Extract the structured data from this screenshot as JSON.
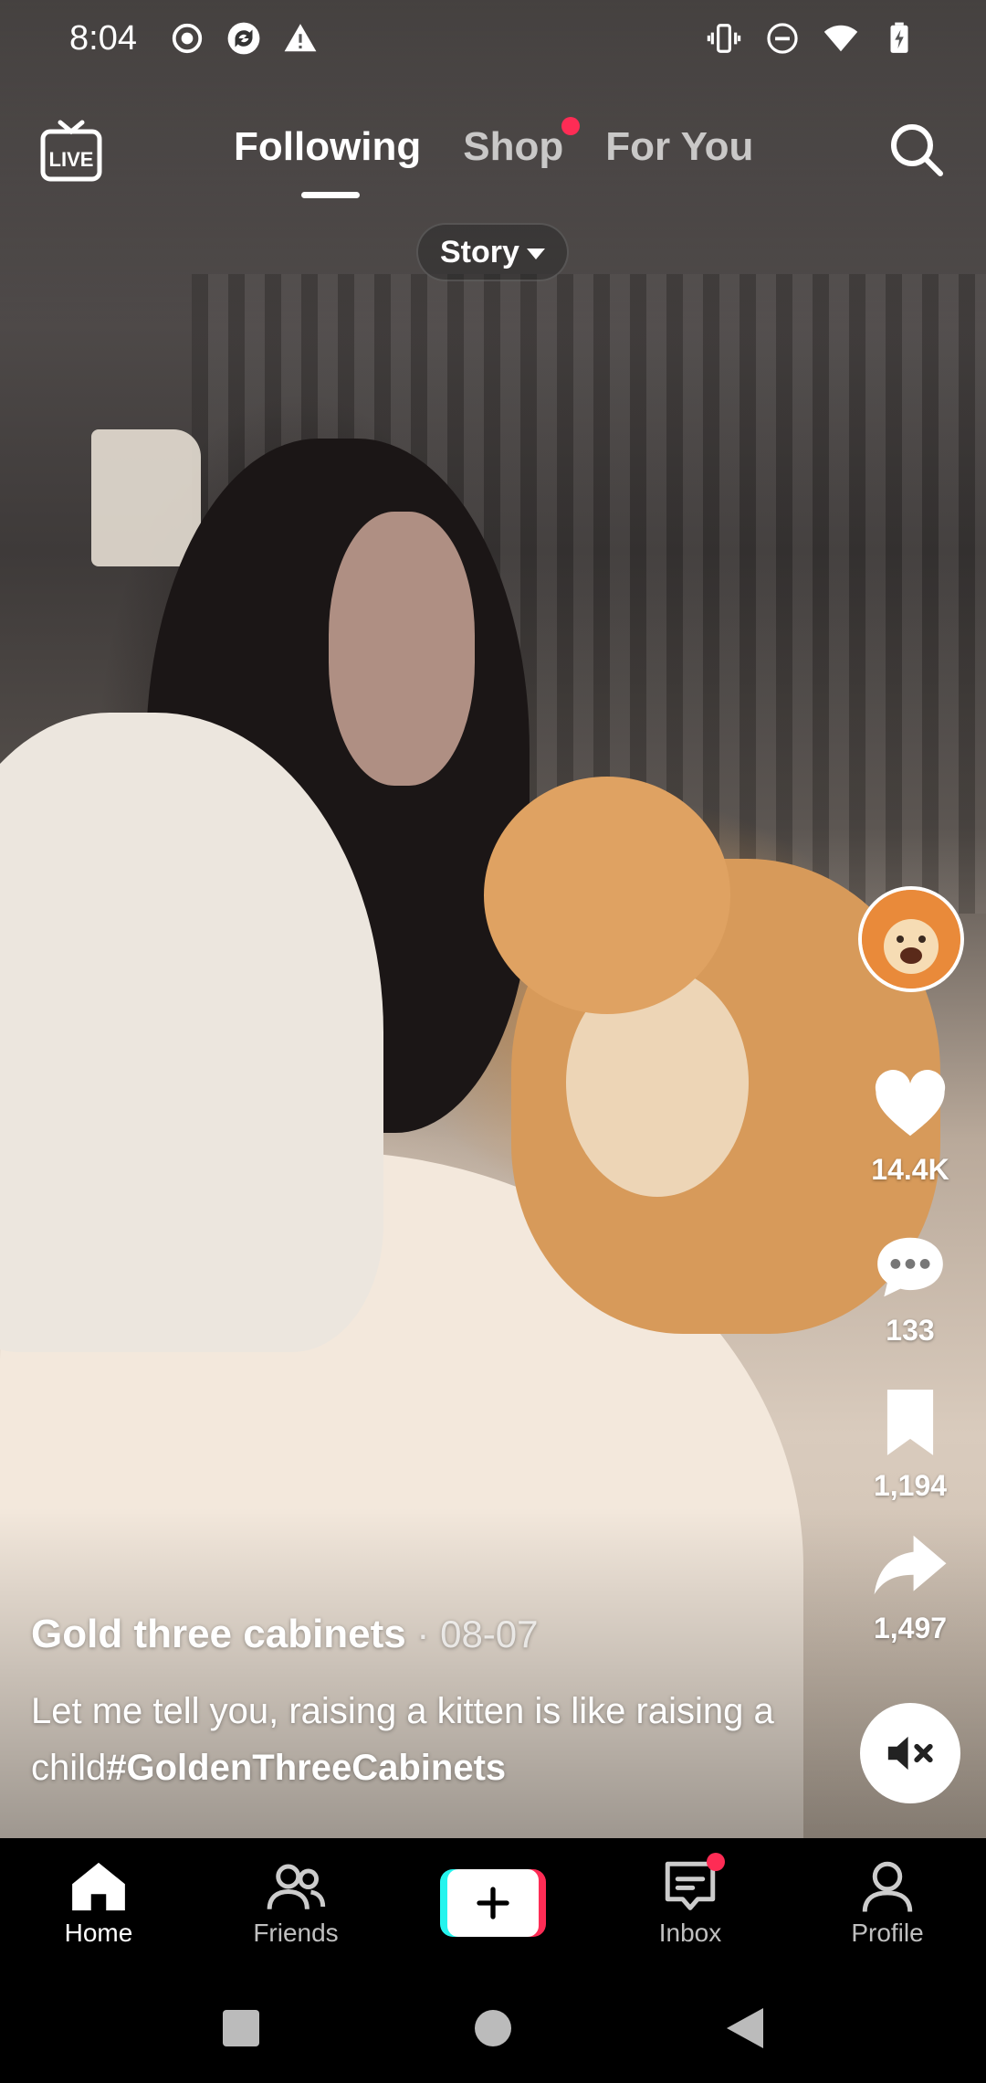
{
  "status_bar": {
    "time": "8:04",
    "left_icons": [
      "record-icon",
      "app-sync-icon",
      "warning-icon"
    ],
    "right_icons": [
      "vibrate-icon",
      "do-not-disturb-icon",
      "wifi-icon",
      "battery-charging-icon"
    ]
  },
  "top_nav": {
    "live_label": "LIVE",
    "tabs": [
      {
        "label": "Following",
        "active": true
      },
      {
        "label": "Shop",
        "active": false,
        "badge_dot": true
      },
      {
        "label": "For You",
        "active": false
      }
    ],
    "story_label": "Story"
  },
  "actions": {
    "likes": "14.4K",
    "comments": "133",
    "saves": "1,194",
    "shares": "1,497"
  },
  "post": {
    "author": "Gold three cabinets",
    "date": " · 08-07",
    "description": "Let me tell you, raising a kitten is like raising a child",
    "hashtag": "#GoldenThreeCabinets"
  },
  "tab_bar": {
    "home": "Home",
    "friends": "Friends",
    "inbox": "Inbox",
    "profile": "Profile"
  },
  "colors": {
    "accent_red": "#fe2c55",
    "accent_cyan": "#25f4ee"
  }
}
